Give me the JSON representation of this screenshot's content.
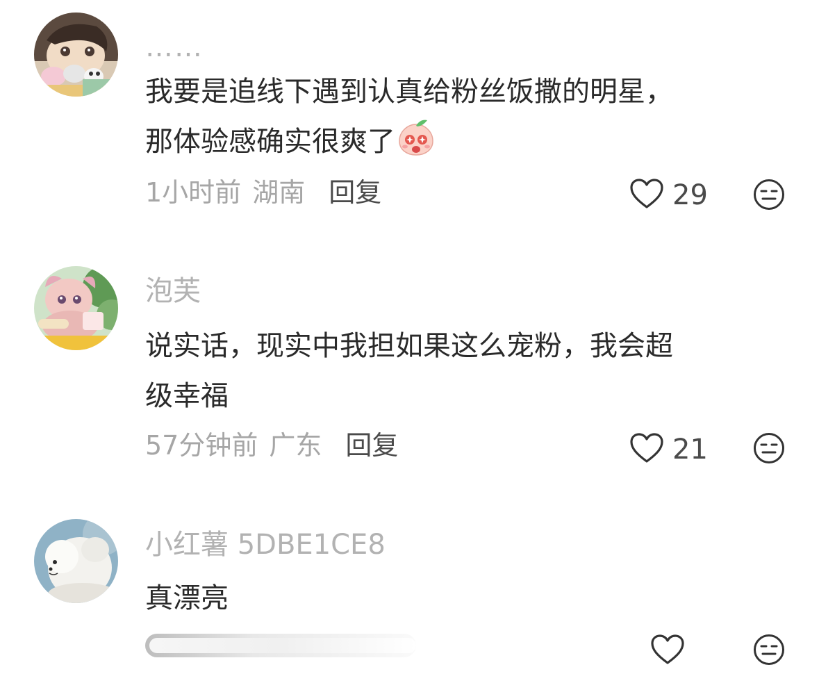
{
  "comments": [
    {
      "username": "……",
      "body_line1": "我要是追线下遇到认真给粉丝饭撒的明星，",
      "body_line2": "那体验感确实很爽了",
      "inline_emoji": "peach-surprised-emoji",
      "time": "1小时前",
      "location": "湖南",
      "reply_label": "回复",
      "like_count": "29"
    },
    {
      "username": "泡芙",
      "body_line1": "说实话，现实中我担如果这么宠粉，我会超",
      "body_line2": "级幸福",
      "time": "57分钟前",
      "location": "广东",
      "reply_label": "回复",
      "like_count": "21"
    },
    {
      "username": "小红薯 5DBE1CE8",
      "body_line1": "真漂亮"
    }
  ],
  "icons": {
    "like": "heart-outline-icon",
    "dislike": "neutral-face-icon"
  },
  "colors": {
    "username": "#b2b2b2",
    "body": "#2a2a2a",
    "meta": "#a6a6a6",
    "reply": "#4a4a4a"
  }
}
